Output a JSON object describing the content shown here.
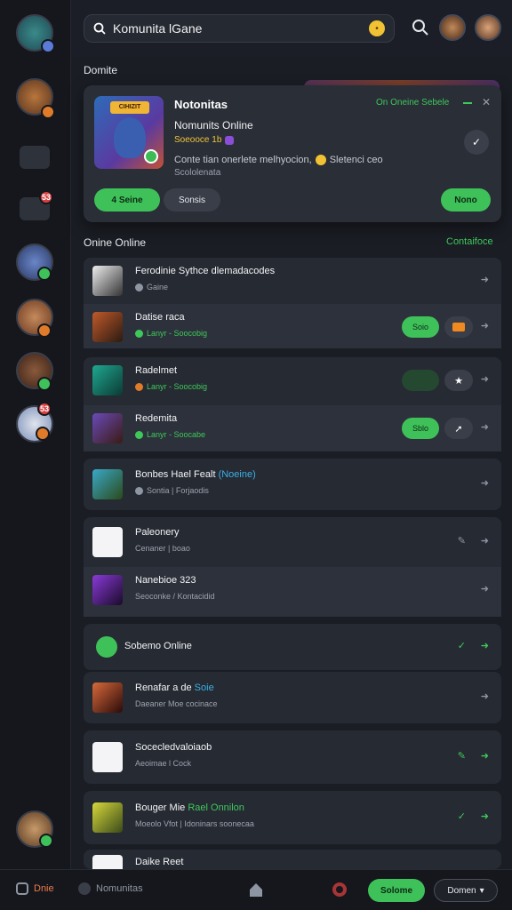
{
  "search": {
    "value": "Komunita lGane"
  },
  "sections": {
    "top": "Domite",
    "online": "Onine Online",
    "online_link": "Contaifoce"
  },
  "feature": {
    "logo_text": "CIHIZIT",
    "title": "Notonitas",
    "status": "On Oneine Sebele",
    "subtitle": "Nomunits Online",
    "meta": "Soeooce 1b",
    "desc": "Conte tian onerlete melhyocion,",
    "desc_extra": "Sletenci ceo",
    "desc2": "Scololenata",
    "btn_primary": "4 Seine",
    "btn_secondary": "Sonsis",
    "btn_right": "Nono"
  },
  "rows": [
    {
      "name": "Ferodinie Sythce dlemadacodes",
      "sub": "Gaine"
    },
    {
      "name": "Datise raca",
      "sub": "Lanyr - Soocobig",
      "pill": "Soio"
    },
    {
      "name": "Radelmet",
      "sub": "Lanyr - Soocobig"
    },
    {
      "name": "Redemita",
      "sub": "Lanyr - Soocabe",
      "pill": "Sblo"
    },
    {
      "name": "Bonbes Hael Fealt",
      "name_accent": "(Noeine)",
      "sub": "Sontia | Forjaodis"
    },
    {
      "name": "Paleonery",
      "sub": "Cenaner | boao"
    },
    {
      "name": "Nanebioe 323",
      "sub": "Seoconke / Kontacidid"
    },
    {
      "name": "Sobemo Online",
      "sub": ""
    },
    {
      "name": "Renafar a de",
      "name_accent": "Soie",
      "sub": "Daeaner Moe cocinace"
    },
    {
      "name": "Socecledvaloiaob",
      "sub": "Aeoimae l Cock"
    },
    {
      "name": "Bouger Mie",
      "name_accent": "Rael Onnilon",
      "sub": "Moeolo Vfot | Idoninars soonecaa"
    },
    {
      "name": "Daike Reet",
      "sub": ""
    }
  ],
  "bottomnav": {
    "first": "Dnie",
    "second": "Nomunitas",
    "btn": "Solome",
    "last": "Domen"
  },
  "colors": {
    "accent_green": "#3fc15a",
    "card": "#262a33",
    "bg": "#1a1d24"
  }
}
